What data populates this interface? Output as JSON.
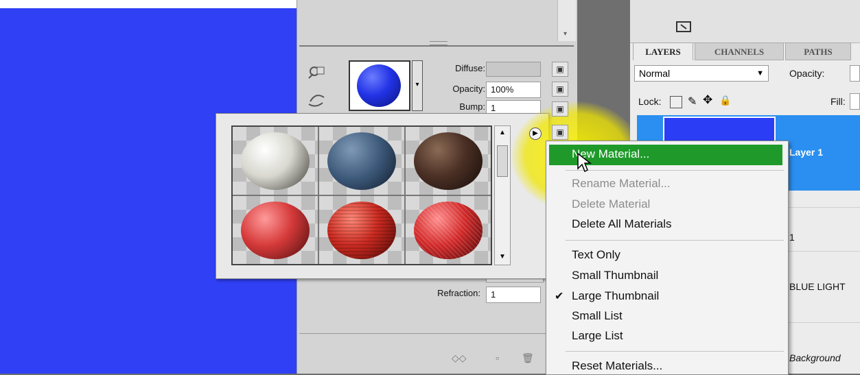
{
  "panel3d": {
    "diffuse_label": "Diffuse:",
    "opacity_label": "Opacity:",
    "opacity_value": "100%",
    "bump_label": "Bump:",
    "bump_value": "1",
    "refraction_label": "Refraction:",
    "refraction_value": "1"
  },
  "materials": [
    {
      "name": "white"
    },
    {
      "name": "steel-blue"
    },
    {
      "name": "dark-brown"
    },
    {
      "name": "red-knit"
    },
    {
      "name": "red-woven"
    },
    {
      "name": "red-mesh"
    }
  ],
  "menu": {
    "new_material": "New Material...",
    "rename_material": "Rename Material...",
    "delete_material": "Delete Material",
    "delete_all": "Delete All Materials",
    "text_only": "Text Only",
    "small_thumbnail": "Small Thumbnail",
    "large_thumbnail": "Large Thumbnail",
    "small_list": "Small List",
    "large_list": "Large List",
    "reset": "Reset Materials...",
    "checkmark": "✔"
  },
  "layers": {
    "tabs": [
      "LAYERS",
      "CHANNELS",
      "PATHS"
    ],
    "blend_mode": "Normal",
    "opacity_label": "Opacity:",
    "lock_label": "Lock:",
    "fill_label": "Fill:",
    "layer1_name": "Layer 1",
    "row2_text": "1",
    "row3_text": "BLUE LIGHT",
    "row4_text": "Background"
  },
  "colors": {
    "canvas_blue": "#2f40f5",
    "menu_highlight": "#1f9a2a",
    "layer_selection": "#2a8ff0",
    "cursor_highlight": "#f5ea00"
  }
}
